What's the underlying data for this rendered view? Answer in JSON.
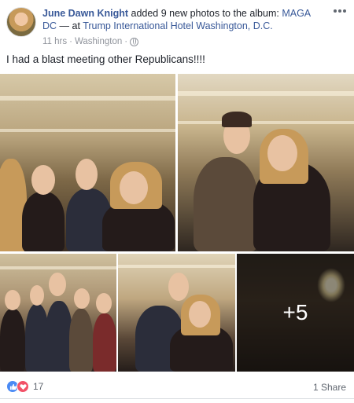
{
  "post": {
    "author": "June Dawn Knight",
    "action_text": " added 9 new photos to the album: ",
    "album": "MAGA DC",
    "location_sep": " — at ",
    "location": "Trump International Hotel Washington, D.C.",
    "time": "11 hrs",
    "dot": " · ",
    "place": "Washington",
    "dot2": " · ",
    "privacy_icon": "globe-icon",
    "body": "I had a blast meeting other Republicans!!!!",
    "more_photos_label": "+5",
    "reaction_icons": [
      "like-icon",
      "love-icon"
    ],
    "reaction_count": "17",
    "share_text": "1 Share"
  },
  "colors": {
    "link": "#385898",
    "meta": "#90949c",
    "like": "#4a8af4",
    "love": "#f25268"
  }
}
